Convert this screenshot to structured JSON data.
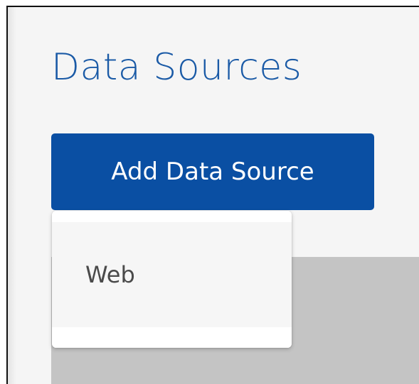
{
  "page": {
    "title": "Data Sources"
  },
  "toolbar": {
    "add_label": "Add Data Source"
  },
  "dropdown": {
    "items": [
      {
        "label": "Web"
      }
    ]
  },
  "colors": {
    "title": "#1a5aa6",
    "button_bg": "#0a4fa3",
    "button_text": "#ffffff",
    "page_bg": "#f5f5f5",
    "panel_bg": "#c4c4c4",
    "menu_bg": "#f6f6f6",
    "menu_text": "#4a4a4a"
  }
}
